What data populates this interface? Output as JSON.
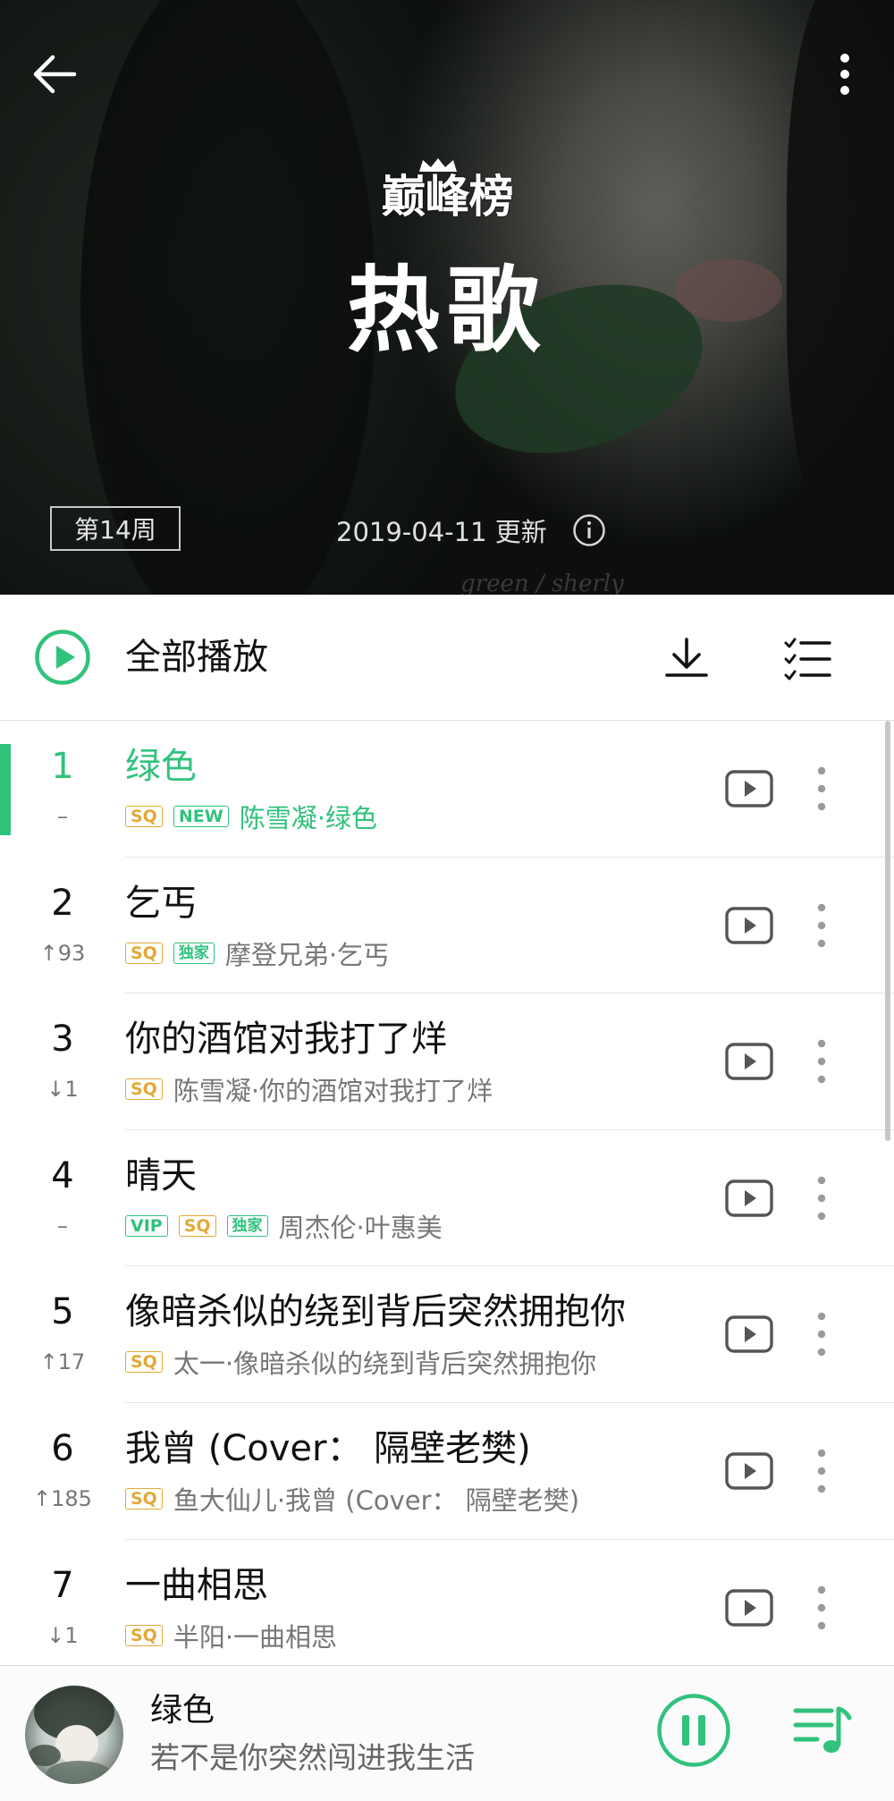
{
  "header": {
    "chart_brand": "巅峰榜",
    "chart_name": "热歌",
    "week_label": "第14周",
    "update_text": "2019-04-11 更新",
    "watermark": "green / sherly"
  },
  "toolbar": {
    "play_all_label": "全部播放"
  },
  "colors": {
    "accent": "#31c27c",
    "sq_tag": "#e3a838"
  },
  "songs": [
    {
      "rank": "1",
      "change": "–",
      "title": "绿色",
      "tags": [
        "SQ",
        "NEW"
      ],
      "artist": "陈雪凝·绿色",
      "active": true
    },
    {
      "rank": "2",
      "change": "↑93",
      "title": "乞丐",
      "tags": [
        "SQ",
        "独家"
      ],
      "artist": "摩登兄弟·乞丐"
    },
    {
      "rank": "3",
      "change": "↓1",
      "title": "你的酒馆对我打了烊",
      "tags": [
        "SQ"
      ],
      "artist": "陈雪凝·你的酒馆对我打了烊"
    },
    {
      "rank": "4",
      "change": "–",
      "title": "晴天",
      "tags": [
        "VIP",
        "SQ",
        "独家"
      ],
      "artist": "周杰伦·叶惠美"
    },
    {
      "rank": "5",
      "change": "↑17",
      "title": "像暗杀似的绕到背后突然拥抱你",
      "tags": [
        "SQ"
      ],
      "artist": "太一·像暗杀似的绕到背后突然拥抱你"
    },
    {
      "rank": "6",
      "change": "↑185",
      "title": "我曾 (Cover： 隔壁老樊)",
      "tags": [
        "SQ"
      ],
      "artist": "鱼大仙儿·我曾 (Cover： 隔壁老樊)"
    },
    {
      "rank": "7",
      "change": "↓1",
      "title": "一曲相思",
      "tags": [
        "SQ"
      ],
      "artist": "半阳·一曲相思"
    }
  ],
  "now_playing": {
    "title": "绿色",
    "lyric": "若不是你突然闯进我生活",
    "state": "playing"
  }
}
